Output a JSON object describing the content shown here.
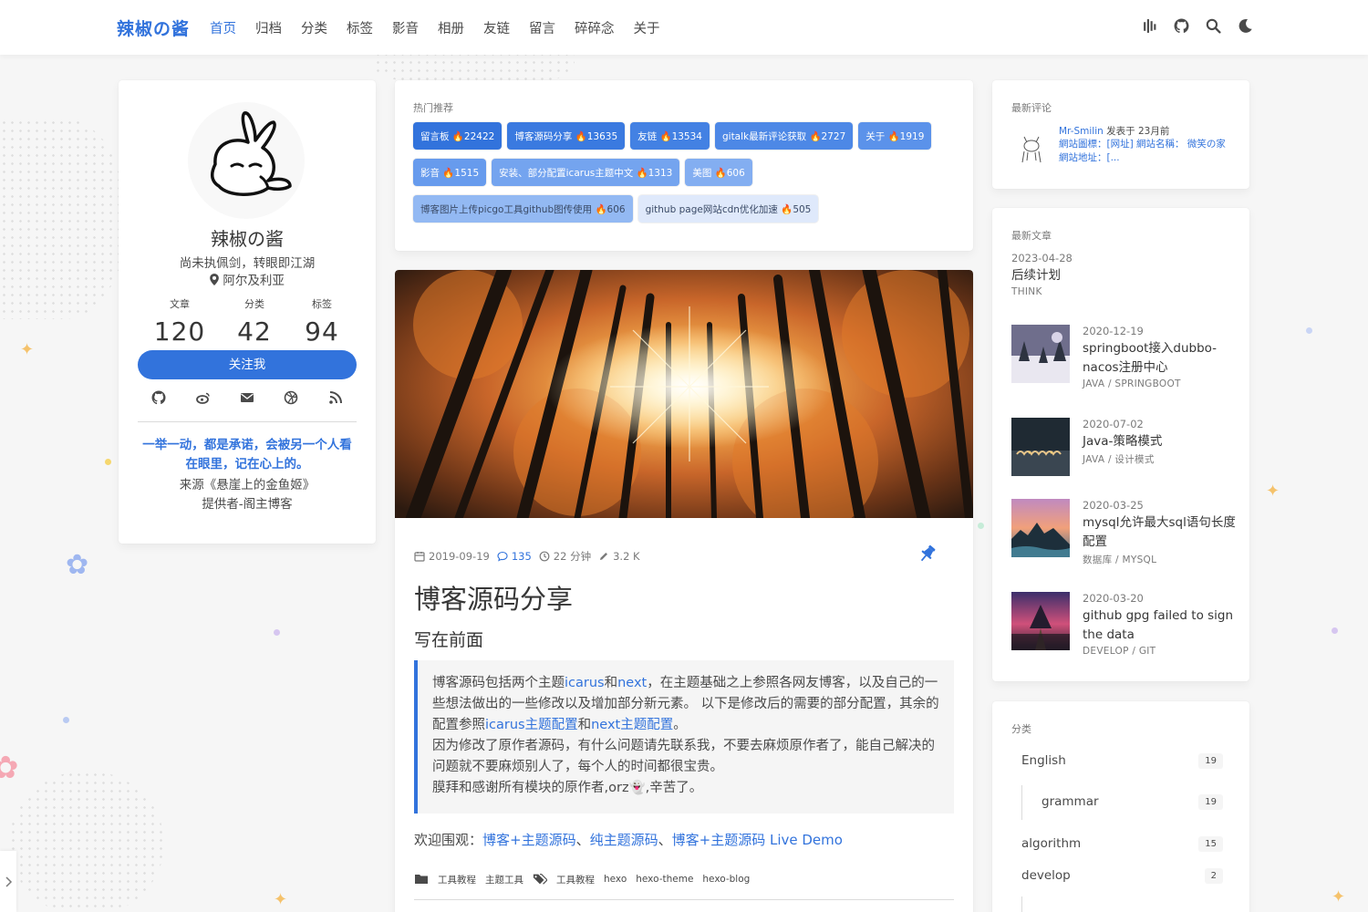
{
  "navbar": {
    "brand": "辣椒の酱",
    "items": [
      "首页",
      "归档",
      "分类",
      "标签",
      "影音",
      "相册",
      "友链",
      "留言",
      "碎碎念",
      "关于"
    ],
    "active_index": 0
  },
  "profile": {
    "name": "辣椒の酱",
    "motto": "尚未执佩剑，转眼即江湖",
    "location": "阿尔及利亚",
    "stats": [
      {
        "label": "文章",
        "value": "120"
      },
      {
        "label": "分类",
        "value": "42"
      },
      {
        "label": "标签",
        "value": "94"
      }
    ],
    "follow_label": "关注我",
    "quote": "一举一动，都是承诺，会被另一个人看在眼里，记在心上的。",
    "source": "来源《悬崖上的金鱼姬》",
    "provider": "提供者-阁主博客"
  },
  "hot": {
    "title": "热门推荐",
    "tags": [
      {
        "label": "留言板 🔥22422",
        "bg": "#3273dc",
        "fg": "#ffffff"
      },
      {
        "label": "博客源码分享 🔥13635",
        "bg": "#3a7ae0",
        "fg": "#ffffff"
      },
      {
        "label": "友链 🔥13534",
        "bg": "#4381e3",
        "fg": "#ffffff"
      },
      {
        "label": "gitalk最新评论获取 🔥2727",
        "bg": "#4d88e6",
        "fg": "#ffffff"
      },
      {
        "label": "关于 🔥1919",
        "bg": "#5b92ea",
        "fg": "#ffffff"
      },
      {
        "label": "影音 🔥1515",
        "bg": "#679bed",
        "fg": "#ffffff"
      },
      {
        "label": "安装、部分配置icarus主题中文 🔥1313",
        "bg": "#74a4ef",
        "fg": "#ffffff"
      },
      {
        "label": "美图 🔥606",
        "bg": "#83aef1",
        "fg": "#ffffff"
      },
      {
        "label": "博客图片上传picgo工具github图传使用 🔥606",
        "bg": "#93b9f3",
        "fg": "#3a4a66"
      },
      {
        "label": "github page网站cdn优化加速 🔥505",
        "bg": "#dfe9fb",
        "fg": "#3a4a66"
      }
    ]
  },
  "article": {
    "date": "2019-09-19",
    "comments": "135",
    "read_time": "22 分钟",
    "words": "3.2 K",
    "title": "博客源码分享",
    "subtitle": "写在前面",
    "quote": {
      "p1a": "博客源码包括两个主题",
      "l1": "icarus",
      "p1b": "和",
      "l2": "next",
      "p1c": "，在主题基础之上参照各网友博客，以及自己的一些想法做出的一些修改以及增加部分新元素。 以下是修改后的需要的部分配置，其余的配置参照",
      "l3": "icarus主题配置",
      "p1d": "和",
      "l4": "next主题配置",
      "p1e": "。",
      "p2": "因为修改了原作者源码，有什么问题请先联系我，不要去麻烦原作者了，能自己解决的问题就不要麻烦别人了，每个人的时间都很宝贵。",
      "p3": "膜拜和感谢所有模块的原作者,orz👻,辛苦了。"
    },
    "welcome_prefix": "欢迎围观：",
    "welcome_links": [
      "博客+主题源码",
      "纯主题源码",
      "博客+主题源码 Live Demo"
    ],
    "welcome_sep": "、",
    "categories": [
      "工具教程",
      "主题工具"
    ],
    "tags": [
      "工具教程",
      "hexo",
      "hexo-theme",
      "hexo-blog"
    ]
  },
  "recent_comments": {
    "title": "最新评论",
    "user": "Mr-Smilin",
    "when": " 发表于 23月前",
    "body": "網站圖標：[网址] 網站名稱： 微笑の家 網站地址：[..."
  },
  "recent_posts": {
    "title": "最新文章",
    "items": [
      {
        "date": "2023-04-28",
        "title": "后续计划",
        "cat": "THINK"
      },
      {
        "date": "2020-12-19",
        "title": "springboot接入dubbo-nacos注册中心",
        "cat": "JAVA / SPRINGBOOT"
      },
      {
        "date": "2020-07-02",
        "title": "Java-策略模式",
        "cat": "JAVA / 设计模式"
      },
      {
        "date": "2020-03-25",
        "title": "mysql允许最大sql语句长度配置",
        "cat": "数据库 / MYSQL"
      },
      {
        "date": "2020-03-20",
        "title": "github gpg failed to sign the data",
        "cat": "DEVELOP / GIT"
      }
    ]
  },
  "categories": {
    "title": "分类",
    "items": [
      {
        "name": "English",
        "count": "19"
      },
      {
        "name": "grammar",
        "count": "19"
      },
      {
        "name": "algorithm",
        "count": "15"
      },
      {
        "name": "develop",
        "count": "2"
      }
    ]
  },
  "colors": {
    "accent": "#3273dc",
    "text": "#4a4a4a",
    "heading": "#363636",
    "muted": "#7a7a7a"
  }
}
